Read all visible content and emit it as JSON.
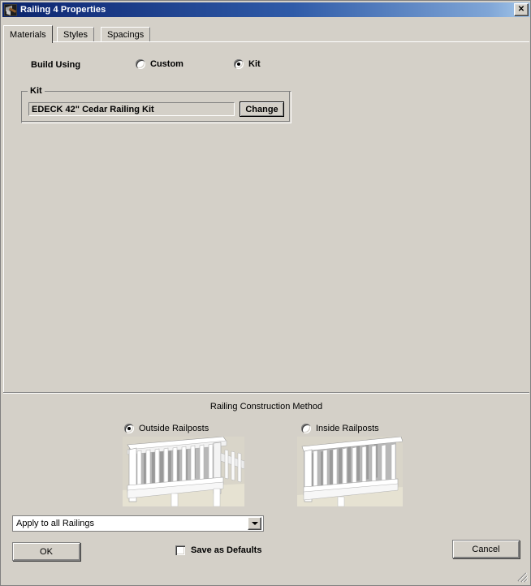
{
  "window": {
    "title": "Railing 4 Properties",
    "icon": "railing-tool-icon",
    "close_label": "✕"
  },
  "tabs": [
    {
      "label": "Materials",
      "active": true
    },
    {
      "label": "Styles",
      "active": false
    },
    {
      "label": "Spacings",
      "active": false
    }
  ],
  "materials": {
    "build_using_label": "Build Using",
    "build_options": [
      {
        "label": "Custom",
        "selected": false
      },
      {
        "label": "Kit",
        "selected": true
      }
    ],
    "kit_group": {
      "legend": "Kit",
      "value": "EDECK 42\" Cedar Railing Kit",
      "change_label": "Change"
    }
  },
  "construction": {
    "title": "Railing Construction Method",
    "options": [
      {
        "label": "Outside Railposts",
        "selected": true
      },
      {
        "label": "Inside Railposts",
        "selected": false
      }
    ]
  },
  "footer": {
    "apply_scope": "Apply to all Railings",
    "ok_label": "OK",
    "cancel_label": "Cancel",
    "save_defaults_label": "Save as Defaults",
    "save_defaults_checked": false
  },
  "colors": {
    "titlebar_start": "#0a246a",
    "titlebar_end": "#a6c8ea",
    "dialog_face": "#d4d0c8",
    "text": "#000000"
  }
}
